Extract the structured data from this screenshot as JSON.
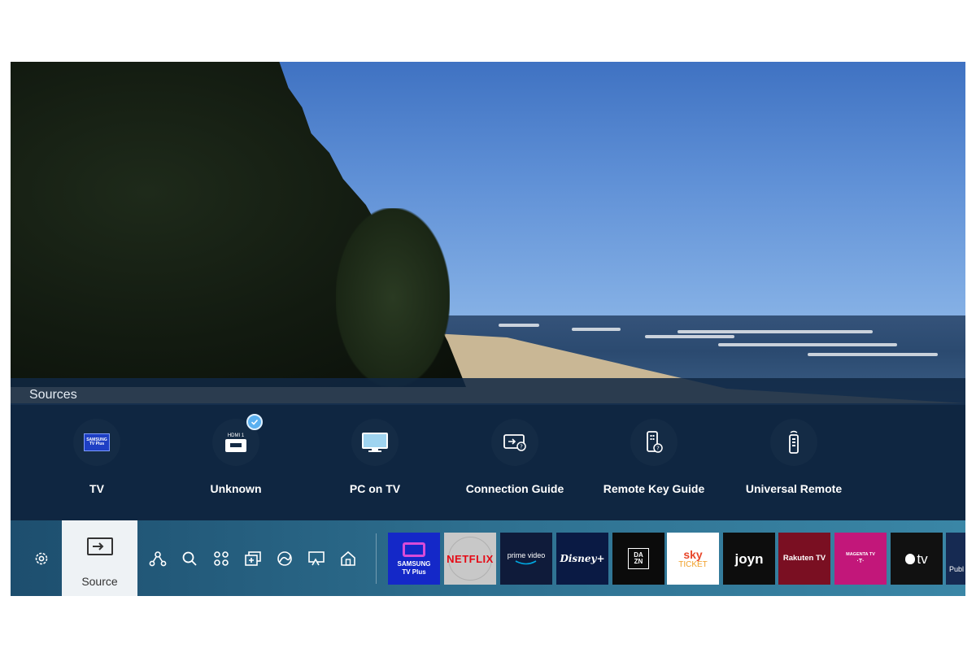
{
  "sources": {
    "title": "Sources",
    "items": [
      {
        "label": "TV",
        "icon": "samsung-tv-plus-icon",
        "badge_text": "SAMSUNG TV Plus"
      },
      {
        "label": "Unknown",
        "icon": "hdmi-icon",
        "badge_text": "HDMI 1",
        "selected": true
      },
      {
        "label": "PC on TV",
        "icon": "monitor-icon"
      },
      {
        "label": "Connection Guide",
        "icon": "connection-guide-icon"
      },
      {
        "label": "Remote Key Guide",
        "icon": "remote-key-guide-icon"
      },
      {
        "label": "Universal Remote",
        "icon": "universal-remote-icon"
      }
    ]
  },
  "bottom_bar": {
    "source_label": "Source",
    "icons": [
      "settings-icon",
      "source-icon",
      "connected-devices-icon",
      "search-icon",
      "apps-icon",
      "media-icon",
      "ambient-icon",
      "screen-mirroring-icon",
      "home-icon"
    ],
    "apps": [
      {
        "name": "samsung-tv-plus",
        "line1": "SAMSUNG",
        "line2": "TV Plus",
        "bg": "#1428c8",
        "fg": "#ffffff"
      },
      {
        "name": "netflix",
        "line1": "NETFLIX",
        "bg": "#c8c8c8",
        "fg": "#e50914"
      },
      {
        "name": "prime-video",
        "line1": "prime video",
        "bg": "#0f1b3a",
        "fg": "#ffffff"
      },
      {
        "name": "disney-plus",
        "line1": "Disney+",
        "bg": "#0a1a44",
        "fg": "#ffffff"
      },
      {
        "name": "dazn",
        "line1": "DA",
        "line2": "ZN",
        "bg": "#0b0b0b",
        "fg": "#ffffff"
      },
      {
        "name": "sky-ticket",
        "line1": "sky",
        "line2": "TICKET",
        "bg": "#ffffff",
        "fg": "#e8462a"
      },
      {
        "name": "joyn",
        "line1": "joyn",
        "bg": "#0d0d0d",
        "fg": "#ffffff"
      },
      {
        "name": "rakuten-tv",
        "line1": "Rakuten TV",
        "bg": "#7a0f22",
        "fg": "#ffffff"
      },
      {
        "name": "magenta-tv",
        "line1": "MAGENTA TV",
        "line2": "·T·",
        "bg": "#c2177a",
        "fg": "#ffffff"
      },
      {
        "name": "apple-tv",
        "line1": "tv",
        "bg": "#111111",
        "fg": "#ffffff"
      },
      {
        "name": "public",
        "line1": "Publ",
        "bg": "#162a52",
        "fg": "#ffffff"
      }
    ]
  }
}
